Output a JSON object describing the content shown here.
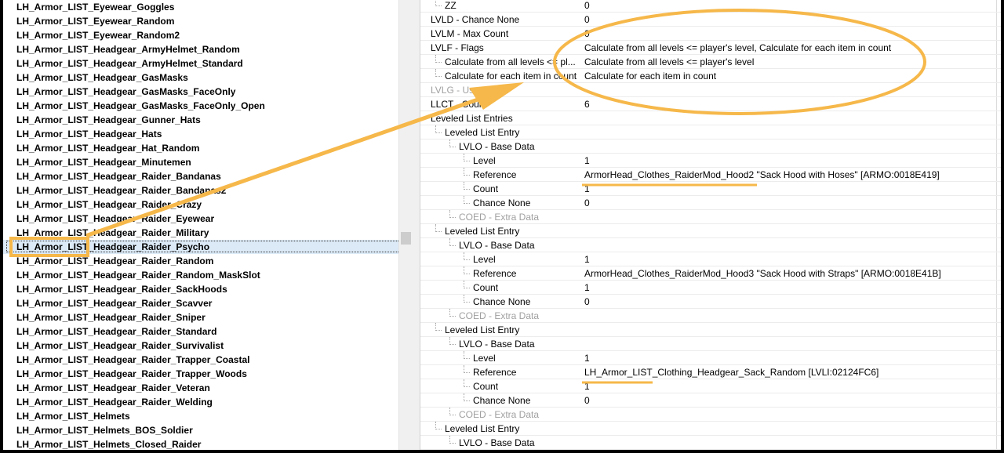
{
  "left_items": [
    "LH_Armor_LIST_Eyewear_Goggles",
    "LH_Armor_LIST_Eyewear_Random",
    "LH_Armor_LIST_Eyewear_Random2",
    "LH_Armor_LIST_Headgear_ArmyHelmet_Random",
    "LH_Armor_LIST_Headgear_ArmyHelmet_Standard",
    "LH_Armor_LIST_Headgear_GasMasks",
    "LH_Armor_LIST_Headgear_GasMasks_FaceOnly",
    "LH_Armor_LIST_Headgear_GasMasks_FaceOnly_Open",
    "LH_Armor_LIST_Headgear_Gunner_Hats",
    "LH_Armor_LIST_Headgear_Hats",
    "LH_Armor_LIST_Headgear_Hat_Random",
    "LH_Armor_LIST_Headgear_Minutemen",
    "LH_Armor_LIST_Headgear_Raider_Bandanas",
    "LH_Armor_LIST_Headgear_Raider_Bandanas2",
    "LH_Armor_LIST_Headgear_Raider_Crazy",
    "LH_Armor_LIST_Headgear_Raider_Eyewear",
    "LH_Armor_LIST_Headgear_Raider_Military",
    "LH_Armor_LIST_Headgear_Raider_Psycho",
    "LH_Armor_LIST_Headgear_Raider_Random",
    "LH_Armor_LIST_Headgear_Raider_Random_MaskSlot",
    "LH_Armor_LIST_Headgear_Raider_SackHoods",
    "LH_Armor_LIST_Headgear_Raider_Scavver",
    "LH_Armor_LIST_Headgear_Raider_Sniper",
    "LH_Armor_LIST_Headgear_Raider_Standard",
    "LH_Armor_LIST_Headgear_Raider_Survivalist",
    "LH_Armor_LIST_Headgear_Raider_Trapper_Coastal",
    "LH_Armor_LIST_Headgear_Raider_Trapper_Woods",
    "LH_Armor_LIST_Headgear_Raider_Veteran",
    "LH_Armor_LIST_Headgear_Raider_Welding",
    "LH_Armor_LIST_Helmets",
    "LH_Armor_LIST_Helmets_BOS_Soldier",
    "LH_Armor_LIST_Helmets_Closed_Raider"
  ],
  "selected_index": 17,
  "right_rows": [
    {
      "indent": 1,
      "key": "ZZ",
      "value": "0"
    },
    {
      "indent": 0,
      "key": "LVLD - Chance None",
      "value": "0"
    },
    {
      "indent": 0,
      "key": "LVLM - Max Count",
      "value": "0"
    },
    {
      "indent": 0,
      "key": "LVLF - Flags",
      "value": "Calculate from all levels <= player's level, Calculate for each item in count"
    },
    {
      "indent": 1,
      "key": "Calculate from all levels <= pl...",
      "value": "Calculate from all levels <= player's level"
    },
    {
      "indent": 1,
      "key": "Calculate for each item in count",
      "value": "Calculate for each item in count"
    },
    {
      "indent": 0,
      "key": "LVLG - Use Global",
      "value": "",
      "dim": true
    },
    {
      "indent": 0,
      "key": "LLCT - Count",
      "value": "6"
    },
    {
      "indent": 0,
      "key": "Leveled List Entries",
      "value": ""
    },
    {
      "indent": 1,
      "key": "Leveled List Entry",
      "value": ""
    },
    {
      "indent": 2,
      "key": "LVLO - Base Data",
      "value": ""
    },
    {
      "indent": 3,
      "key": "Level",
      "value": "1"
    },
    {
      "indent": 3,
      "key": "Reference",
      "value": "ArmorHead_Clothes_RaiderMod_Hood2 \"Sack Hood with Hoses\" [ARMO:0018E419]"
    },
    {
      "indent": 3,
      "key": "Count",
      "value": "1"
    },
    {
      "indent": 3,
      "key": "Chance None",
      "value": "0"
    },
    {
      "indent": 2,
      "key": "COED - Extra Data",
      "value": "",
      "dim": true
    },
    {
      "indent": 1,
      "key": "Leveled List Entry",
      "value": ""
    },
    {
      "indent": 2,
      "key": "LVLO - Base Data",
      "value": ""
    },
    {
      "indent": 3,
      "key": "Level",
      "value": "1"
    },
    {
      "indent": 3,
      "key": "Reference",
      "value": "ArmorHead_Clothes_RaiderMod_Hood3 \"Sack Hood with Straps\" [ARMO:0018E41B]"
    },
    {
      "indent": 3,
      "key": "Count",
      "value": "1"
    },
    {
      "indent": 3,
      "key": "Chance None",
      "value": "0"
    },
    {
      "indent": 2,
      "key": "COED - Extra Data",
      "value": "",
      "dim": true
    },
    {
      "indent": 1,
      "key": "Leveled List Entry",
      "value": ""
    },
    {
      "indent": 2,
      "key": "LVLO - Base Data",
      "value": ""
    },
    {
      "indent": 3,
      "key": "Level",
      "value": "1"
    },
    {
      "indent": 3,
      "key": "Reference",
      "value": "LH_Armor_LIST_Clothing_Headgear_Sack_Random [LVLI:02124FC6]"
    },
    {
      "indent": 3,
      "key": "Count",
      "value": "1"
    },
    {
      "indent": 3,
      "key": "Chance None",
      "value": "0"
    },
    {
      "indent": 2,
      "key": "COED - Extra Data",
      "value": "",
      "dim": true
    },
    {
      "indent": 1,
      "key": "Leveled List Entry",
      "value": ""
    },
    {
      "indent": 2,
      "key": "LVLO - Base Data",
      "value": ""
    }
  ],
  "colors": {
    "annotation": "#f6b84a",
    "selection": "#dceaf7"
  }
}
